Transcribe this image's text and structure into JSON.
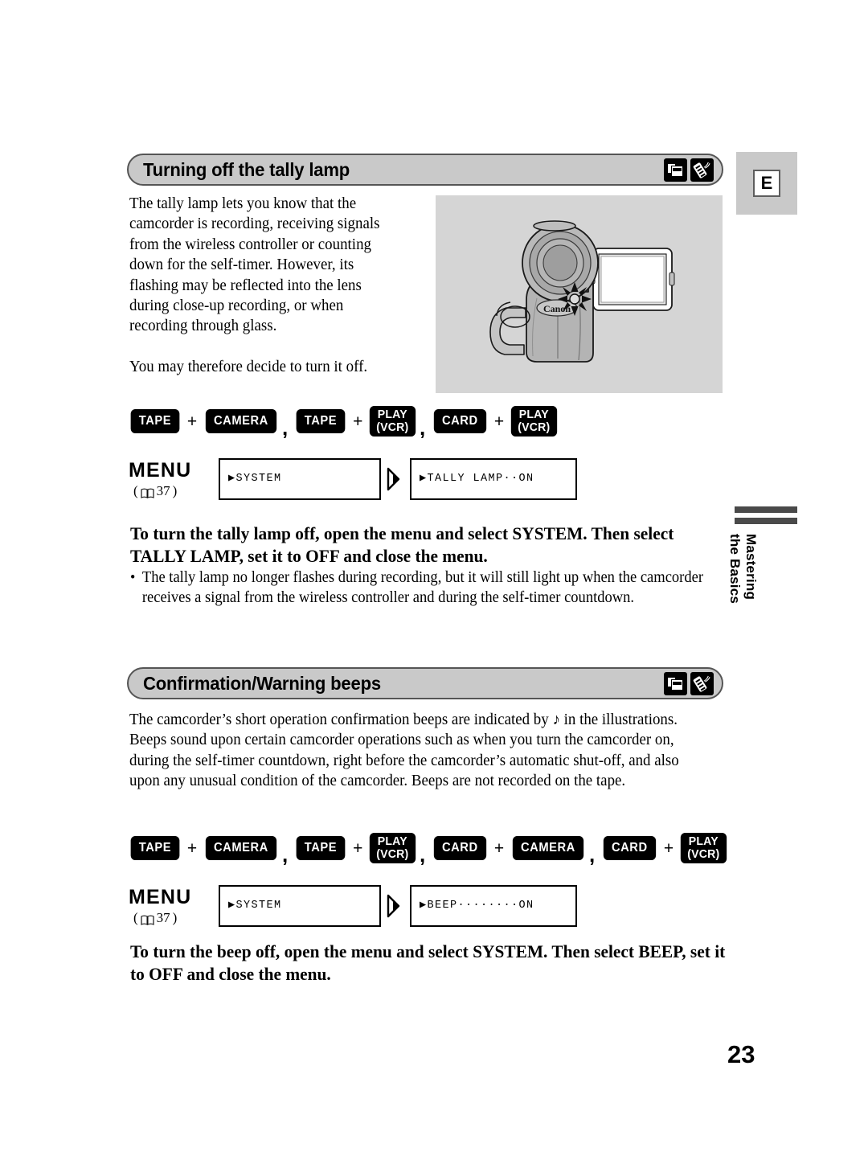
{
  "page": {
    "number": "23",
    "language_tab": "E",
    "chapter_marker": "Mastering\nthe Basics"
  },
  "sections": [
    {
      "title": "Turning off the tally lamp",
      "icons": [
        "cassette-tape-icon",
        "wireless-remote-icon"
      ],
      "paragraphs": [
        "The tally lamp lets you know that the camcorder is recording, receiving signals from the wireless controller or counting down for the self-timer. However, its flashing may be reflected into the lens during close-up recording, or when recording through glass.",
        "You may therefore decide to turn it off."
      ],
      "illustration": {
        "name": "camcorder-tally-lamp-illustration",
        "brand_label": "Canon"
      },
      "mode_groups": [
        {
          "left": "TAPE",
          "right_line1": "CAMERA",
          "right_line2": ""
        },
        {
          "left": "TAPE",
          "right_line1": "PLAY",
          "right_line2": "(VCR)"
        },
        {
          "left": "CARD",
          "right_line1": "PLAY",
          "right_line2": "(VCR)"
        }
      ],
      "menu": {
        "label": "MENU",
        "reference_page": "37",
        "step1": "▶SYSTEM",
        "step2": "▶TALLY LAMP··ON"
      },
      "instruction": "To turn the tally lamp off, open the menu and select SYSTEM. Then select TALLY LAMP, set it to OFF and close the menu.",
      "bullets": [
        "The tally lamp no longer flashes during recording, but it will still light up when the camcorder receives a signal from the wireless controller and during the self-timer countdown."
      ]
    },
    {
      "title": "Confirmation/Warning beeps",
      "icons": [
        "cassette-tape-icon",
        "wireless-remote-icon"
      ],
      "paragraphs": [
        "The camcorder’s short operation confirmation beeps are indicated by ♪ in the illustrations. Beeps sound upon certain camcorder operations such as when you turn the camcorder on, during the self-timer countdown, right before the camcorder’s automatic shut-off, and also upon any unusual condition of the camcorder. Beeps are not recorded on the tape."
      ],
      "mode_groups": [
        {
          "left": "TAPE",
          "right_line1": "CAMERA",
          "right_line2": ""
        },
        {
          "left": "TAPE",
          "right_line1": "PLAY",
          "right_line2": "(VCR)"
        },
        {
          "left": "CARD",
          "right_line1": "CAMERA",
          "right_line2": ""
        },
        {
          "left": "CARD",
          "right_line1": "PLAY",
          "right_line2": "(VCR)"
        }
      ],
      "menu": {
        "label": "MENU",
        "reference_page": "37",
        "step1": "▶SYSTEM",
        "step2": "▶BEEP········ON"
      },
      "instruction": "To turn the beep off, open the menu and select SYSTEM. Then select BEEP, set it to OFF and close the menu.",
      "bullets": []
    }
  ],
  "symbols": {
    "plus": "+",
    "comma": ",",
    "bullet": "•",
    "menu_ref_open": "(",
    "menu_ref_close": ")"
  },
  "colors": {
    "header_bar": "#c9c9c9",
    "header_border": "#555555",
    "badge_bg": "#000000",
    "badge_text": "#ffffff",
    "illustration_bg": "#d5d5d5",
    "marker_bar": "#4a4a4a"
  }
}
